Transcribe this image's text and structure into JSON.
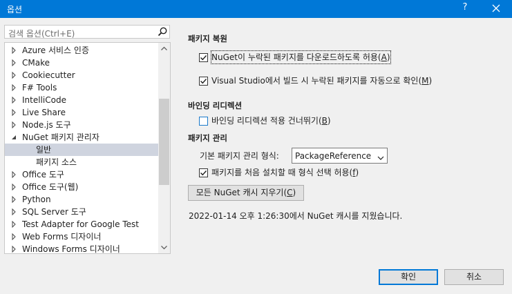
{
  "window": {
    "title": "옵션",
    "help_label": "?"
  },
  "search": {
    "placeholder": "검색 옵션(Ctrl+E)"
  },
  "tree": {
    "items": [
      {
        "label": "Azure 서비스 인증",
        "expander": "collapsed",
        "level": 0
      },
      {
        "label": "CMake",
        "expander": "collapsed",
        "level": 0
      },
      {
        "label": "Cookiecutter",
        "expander": "collapsed",
        "level": 0
      },
      {
        "label": "F# Tools",
        "expander": "collapsed",
        "level": 0
      },
      {
        "label": "IntelliCode",
        "expander": "collapsed",
        "level": 0
      },
      {
        "label": "Live Share",
        "expander": "collapsed",
        "level": 0
      },
      {
        "label": "Node.js 도구",
        "expander": "collapsed",
        "level": 0
      },
      {
        "label": "NuGet 패키지 관리자",
        "expander": "expanded",
        "level": 0
      },
      {
        "label": "일반",
        "expander": "none",
        "level": 1,
        "selected": true
      },
      {
        "label": "패키지 소스",
        "expander": "none",
        "level": 1
      },
      {
        "label": "Office 도구",
        "expander": "collapsed",
        "level": 0
      },
      {
        "label": "Office 도구(웹)",
        "expander": "collapsed",
        "level": 0
      },
      {
        "label": "Python",
        "expander": "collapsed",
        "level": 0
      },
      {
        "label": "SQL Server 도구",
        "expander": "collapsed",
        "level": 0
      },
      {
        "label": "Test Adapter for Google Test",
        "expander": "collapsed",
        "level": 0
      },
      {
        "label": "Web Forms 디자이너",
        "expander": "collapsed",
        "level": 0
      },
      {
        "label": "Windows Forms 디자이너",
        "expander": "collapsed",
        "level": 0
      }
    ]
  },
  "package_restore": {
    "heading": "패키지 복원",
    "allow_download": {
      "text": "NuGet이 누락된 패키지를 다운로드하도록 허용",
      "mnemonic": "A",
      "checked": true
    },
    "auto_check": {
      "text": "Visual Studio에서 빌드 시 누락된 패키지를 자동으로 확인",
      "mnemonic": "M",
      "checked": true
    }
  },
  "binding_redirects": {
    "heading": "바인딩 리디렉션",
    "skip": {
      "text": "바인딩 리디렉션 적용 건너뛰기",
      "mnemonic": "B",
      "checked": false
    }
  },
  "package_management": {
    "heading": "패키지 관리",
    "default_format_label": "기본 패키지 관리 형식:",
    "default_format_value": "PackageReference",
    "allow_format_choice": {
      "text": "패키지를 처음 설치할 때 형식 선택 허용",
      "mnemonic": "f",
      "checked": true
    }
  },
  "clear_cache": {
    "label": "모든 NuGet 캐시 지우기",
    "mnemonic": "C"
  },
  "status_message": "2022-01-14 오후 1:26:30에서 NuGet 캐시를 지웠습니다.",
  "footer": {
    "ok_label": "확인",
    "cancel_label": "취소"
  },
  "colors": {
    "titlebar": "#0078d7",
    "selection": "#cfd4df",
    "accent": "#0078d7"
  }
}
